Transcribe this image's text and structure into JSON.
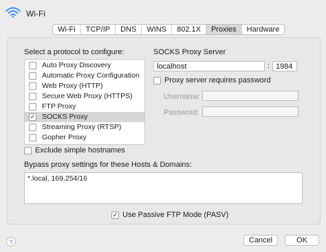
{
  "window": {
    "title": "Wi-Fi"
  },
  "tabs": [
    {
      "label": "Wi-Fi",
      "active": false
    },
    {
      "label": "TCP/IP",
      "active": false
    },
    {
      "label": "DNS",
      "active": false
    },
    {
      "label": "WINS",
      "active": false
    },
    {
      "label": "802.1X",
      "active": false
    },
    {
      "label": "Proxies",
      "active": true
    },
    {
      "label": "Hardware",
      "active": false
    }
  ],
  "protocols": {
    "heading": "Select a protocol to configure:",
    "items": [
      {
        "label": "Auto Proxy Discovery",
        "checked": false,
        "selected": false
      },
      {
        "label": "Automatic Proxy Configuration",
        "checked": false,
        "selected": false
      },
      {
        "label": "Web Proxy (HTTP)",
        "checked": false,
        "selected": false
      },
      {
        "label": "Secure Web Proxy (HTTPS)",
        "checked": false,
        "selected": false
      },
      {
        "label": "FTP Proxy",
        "checked": false,
        "selected": false
      },
      {
        "label": "SOCKS Proxy",
        "checked": true,
        "selected": true
      },
      {
        "label": "Streaming Proxy (RTSP)",
        "checked": false,
        "selected": false
      },
      {
        "label": "Gopher Proxy",
        "checked": false,
        "selected": false
      }
    ]
  },
  "socks": {
    "heading": "SOCKS Proxy Server",
    "server": "localhost",
    "separator": ":",
    "port": "1984",
    "requires_password_label": "Proxy server requires password",
    "requires_password": false,
    "username_label": "Username:",
    "username_value": "",
    "password_label": "Password:",
    "password_value": ""
  },
  "exclude_simple_hostnames": {
    "label": "Exclude simple hostnames",
    "checked": false
  },
  "bypass": {
    "label": "Bypass proxy settings for these Hosts & Domains:",
    "value": "*.local, 169.254/16"
  },
  "passive_ftp": {
    "label": "Use Passive FTP Mode (PASV)",
    "checked": true
  },
  "footer": {
    "help": "?",
    "cancel": "Cancel",
    "ok": "OK"
  },
  "check_mark": "✓"
}
